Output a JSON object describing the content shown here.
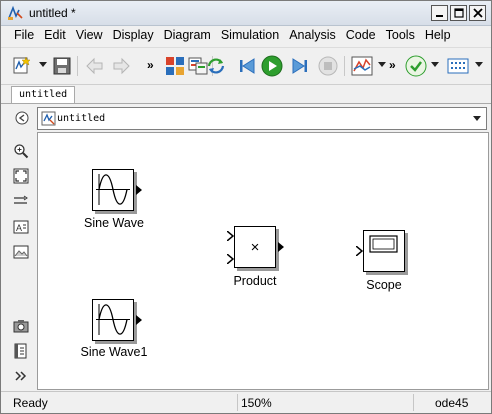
{
  "window": {
    "title": "untitled *"
  },
  "menu": [
    "File",
    "Edit",
    "View",
    "Display",
    "Diagram",
    "Simulation",
    "Analysis",
    "Code",
    "Tools",
    "Help"
  ],
  "toolbar": {
    "more_label": "»"
  },
  "tabs": [
    {
      "label": "untitled"
    }
  ],
  "address": {
    "path": "untitled"
  },
  "blocks": {
    "sine1": {
      "label": "Sine Wave"
    },
    "sine2": {
      "label": "Sine Wave1"
    },
    "product": {
      "label": "Product",
      "symbol": "×"
    },
    "scope": {
      "label": "Scope"
    }
  },
  "status": {
    "state": "Ready",
    "zoom": "150%",
    "solver": "ode45"
  },
  "colors": {
    "accent_green": "#2e9e2e",
    "toolbar_blue": "#2a6ebb",
    "canvas": "#ffffff"
  }
}
